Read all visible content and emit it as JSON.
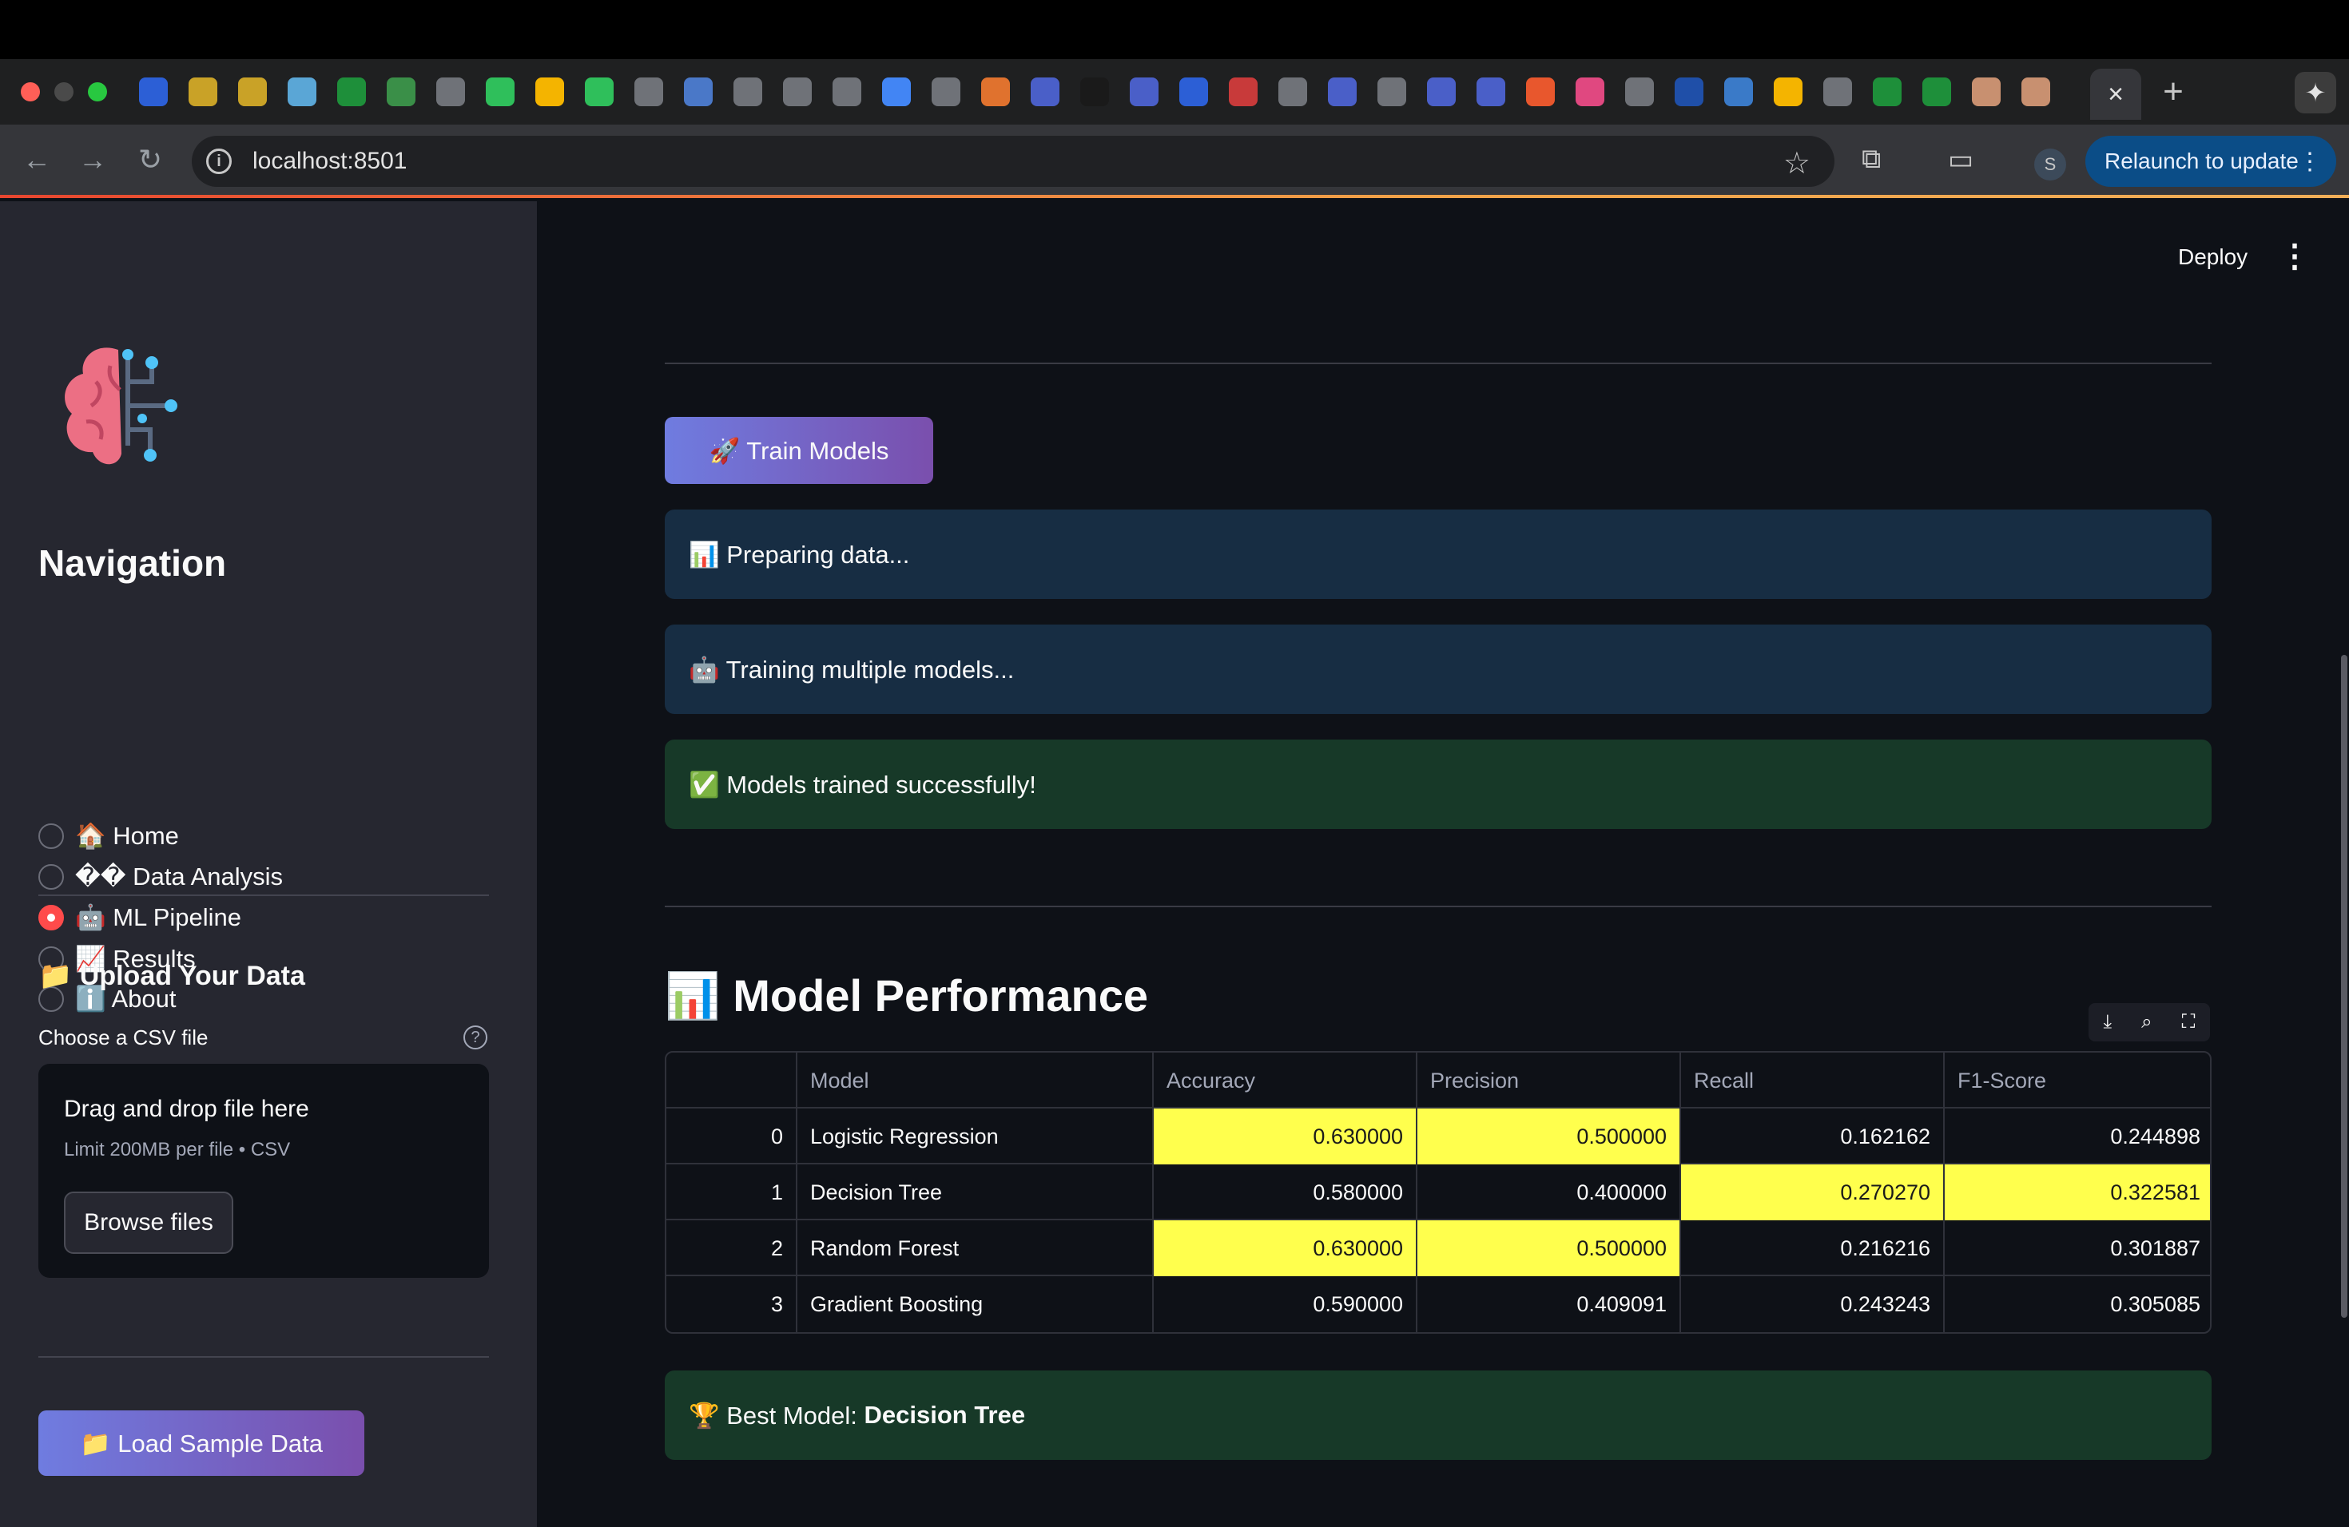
{
  "browser": {
    "url": "localhost:8501",
    "relaunch_label": "Relaunch to update",
    "profile_initial": "S",
    "tab_colors": [
      "#2c5fd6",
      "#c9a227",
      "#c9a227",
      "#5aa6d6",
      "#1e8f3a",
      "#3a8f48",
      "#6f7278",
      "#2fbf5b",
      "#f4b400",
      "#2fbf5b",
      "#6f7278",
      "#4a78c8",
      "#6f7278",
      "#6f7278",
      "#6f7278",
      "#4285f4",
      "#6f7278",
      "#e0722e",
      "#4a5fc8",
      "#1a1a1a",
      "#4a5fc8",
      "#2c5fd6",
      "#c83a3a",
      "#6f7278",
      "#4a5fc8",
      "#6f7278",
      "#4a5fc8",
      "#4a5fc8",
      "#e8572d",
      "#e04880",
      "#6f7278",
      "#1f4fa8",
      "#3a7ac8",
      "#f4b400",
      "#6f7278",
      "#1e8f3a",
      "#1e8f3a",
      "#c89070",
      "#c89070"
    ]
  },
  "app": {
    "deploy_label": "Deploy",
    "sidebar": {
      "nav_title": "Navigation",
      "nav_items": [
        {
          "label": "🏠 Home",
          "selected": false
        },
        {
          "label": "�� Data Analysis",
          "selected": false
        },
        {
          "label": "🤖 ML Pipeline",
          "selected": true
        },
        {
          "label": "📈 Results",
          "selected": false
        },
        {
          "label": "ℹ️ About",
          "selected": false
        }
      ],
      "upload_title": "📁 Upload Your Data",
      "choose_label": "Choose a CSV file",
      "dropzone_title": "Drag and drop file here",
      "dropzone_limit": "Limit 200MB per file • CSV",
      "browse_label": "Browse files",
      "sample_label": "📁 Load Sample Data"
    },
    "main": {
      "train_label": "🚀 Train Models",
      "alerts": [
        {
          "text": "📊 Preparing data...",
          "kind": "info"
        },
        {
          "text": "🤖 Training multiple models...",
          "kind": "info"
        },
        {
          "text": "✅ Models trained successfully!",
          "kind": "success"
        }
      ],
      "performance_title": "📊 Model Performance",
      "table": {
        "columns": [
          "",
          "Model",
          "Accuracy",
          "Precision",
          "Recall",
          "F1-Score"
        ],
        "rows": [
          {
            "index": "0",
            "model": "Logistic Regression",
            "accuracy": "0.630000",
            "precision": "0.500000",
            "recall": "0.162162",
            "f1": "0.244898",
            "highlight": [
              "accuracy",
              "precision"
            ]
          },
          {
            "index": "1",
            "model": "Decision Tree",
            "accuracy": "0.580000",
            "precision": "0.400000",
            "recall": "0.270270",
            "f1": "0.322581",
            "highlight": [
              "recall",
              "f1"
            ]
          },
          {
            "index": "2",
            "model": "Random Forest",
            "accuracy": "0.630000",
            "precision": "0.500000",
            "recall": "0.216216",
            "f1": "0.301887",
            "highlight": [
              "accuracy",
              "precision"
            ]
          },
          {
            "index": "3",
            "model": "Gradient Boosting",
            "accuracy": "0.590000",
            "precision": "0.409091",
            "recall": "0.243243",
            "f1": "0.305085",
            "highlight": []
          }
        ],
        "highlight_color": "#ffff4d"
      },
      "best_model_prefix": "🏆 Best Model: ",
      "best_model_name": "Decision Tree"
    }
  }
}
